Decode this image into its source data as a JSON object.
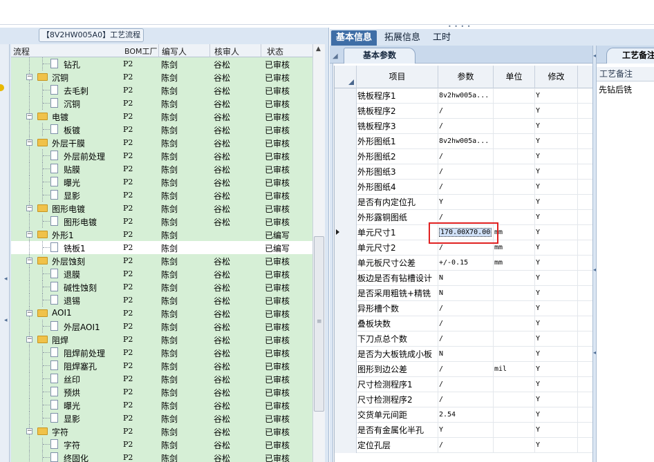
{
  "left": {
    "title": "【8V2HW005A0】工艺流程",
    "headers": {
      "flow": "流程",
      "bom": "BOM工厂",
      "author": "编写人",
      "reviewer": "核审人",
      "status": "状态"
    },
    "rows": [
      {
        "level": 2,
        "type": "doc",
        "name": "钻孔",
        "bom": "P2",
        "author": "陈剑",
        "reviewer": "谷松",
        "status": "已审核"
      },
      {
        "level": 1,
        "type": "folder",
        "name": "沉铜",
        "bom": "P2",
        "author": "陈剑",
        "reviewer": "谷松",
        "status": "已审核"
      },
      {
        "level": 2,
        "type": "doc",
        "name": "去毛刺",
        "bom": "P2",
        "author": "陈剑",
        "reviewer": "谷松",
        "status": "已审核"
      },
      {
        "level": 2,
        "type": "doc",
        "name": "沉铜",
        "bom": "P2",
        "author": "陈剑",
        "reviewer": "谷松",
        "status": "已审核"
      },
      {
        "level": 1,
        "type": "folder",
        "name": "电镀",
        "bom": "P2",
        "author": "陈剑",
        "reviewer": "谷松",
        "status": "已审核"
      },
      {
        "level": 2,
        "type": "doc",
        "name": "板镀",
        "bom": "P2",
        "author": "陈剑",
        "reviewer": "谷松",
        "status": "已审核"
      },
      {
        "level": 1,
        "type": "folder",
        "name": "外层干膜",
        "bom": "P2",
        "author": "陈剑",
        "reviewer": "谷松",
        "status": "已审核"
      },
      {
        "level": 2,
        "type": "doc",
        "name": "外层前处理",
        "bom": "P2",
        "author": "陈剑",
        "reviewer": "谷松",
        "status": "已审核"
      },
      {
        "level": 2,
        "type": "doc",
        "name": "贴膜",
        "bom": "P2",
        "author": "陈剑",
        "reviewer": "谷松",
        "status": "已审核"
      },
      {
        "level": 2,
        "type": "doc",
        "name": "曝光",
        "bom": "P2",
        "author": "陈剑",
        "reviewer": "谷松",
        "status": "已审核"
      },
      {
        "level": 2,
        "type": "doc",
        "name": "显影",
        "bom": "P2",
        "author": "陈剑",
        "reviewer": "谷松",
        "status": "已审核"
      },
      {
        "level": 1,
        "type": "folder",
        "name": "图形电镀",
        "bom": "P2",
        "author": "陈剑",
        "reviewer": "谷松",
        "status": "已审核"
      },
      {
        "level": 2,
        "type": "doc",
        "name": "图形电镀",
        "bom": "P2",
        "author": "陈剑",
        "reviewer": "谷松",
        "status": "已审核"
      },
      {
        "level": 1,
        "type": "folder",
        "name": "外形1",
        "bom": "P2",
        "author": "陈剑",
        "reviewer": "",
        "status": "已编写"
      },
      {
        "level": 2,
        "type": "doc",
        "name": "铣板1",
        "bom": "P2",
        "author": "陈剑",
        "reviewer": "",
        "status": "已编写",
        "selected": true
      },
      {
        "level": 1,
        "type": "folder",
        "name": "外层蚀刻",
        "bom": "P2",
        "author": "陈剑",
        "reviewer": "谷松",
        "status": "已审核"
      },
      {
        "level": 2,
        "type": "doc",
        "name": "退膜",
        "bom": "P2",
        "author": "陈剑",
        "reviewer": "谷松",
        "status": "已审核"
      },
      {
        "level": 2,
        "type": "doc",
        "name": "碱性蚀刻",
        "bom": "P2",
        "author": "陈剑",
        "reviewer": "谷松",
        "status": "已审核"
      },
      {
        "level": 2,
        "type": "doc",
        "name": "退锡",
        "bom": "P2",
        "author": "陈剑",
        "reviewer": "谷松",
        "status": "已审核"
      },
      {
        "level": 1,
        "type": "folder",
        "name": "AOI1",
        "bom": "P2",
        "author": "陈剑",
        "reviewer": "谷松",
        "status": "已审核"
      },
      {
        "level": 2,
        "type": "doc",
        "name": "外层AOI1",
        "bom": "P2",
        "author": "陈剑",
        "reviewer": "谷松",
        "status": "已审核"
      },
      {
        "level": 1,
        "type": "folder",
        "name": "阻焊",
        "bom": "P2",
        "author": "陈剑",
        "reviewer": "谷松",
        "status": "已审核"
      },
      {
        "level": 2,
        "type": "doc",
        "name": "阻焊前处理",
        "bom": "P2",
        "author": "陈剑",
        "reviewer": "谷松",
        "status": "已审核"
      },
      {
        "level": 2,
        "type": "doc",
        "name": "阻焊塞孔",
        "bom": "P2",
        "author": "陈剑",
        "reviewer": "谷松",
        "status": "已审核"
      },
      {
        "level": 2,
        "type": "doc",
        "name": "丝印",
        "bom": "P2",
        "author": "陈剑",
        "reviewer": "谷松",
        "status": "已审核"
      },
      {
        "level": 2,
        "type": "doc",
        "name": "预烘",
        "bom": "P2",
        "author": "陈剑",
        "reviewer": "谷松",
        "status": "已审核"
      },
      {
        "level": 2,
        "type": "doc",
        "name": "曝光",
        "bom": "P2",
        "author": "陈剑",
        "reviewer": "谷松",
        "status": "已审核"
      },
      {
        "level": 2,
        "type": "doc",
        "name": "显影",
        "bom": "P2",
        "author": "陈剑",
        "reviewer": "谷松",
        "status": "已审核"
      },
      {
        "level": 1,
        "type": "folder",
        "name": "字符",
        "bom": "P2",
        "author": "陈剑",
        "reviewer": "谷松",
        "status": "已审核"
      },
      {
        "level": 2,
        "type": "doc",
        "name": "字符",
        "bom": "P2",
        "author": "陈剑",
        "reviewer": "谷松",
        "status": "已审核"
      },
      {
        "level": 2,
        "type": "doc",
        "name": "终固化",
        "bom": "P2",
        "author": "陈剑",
        "reviewer": "谷松",
        "status": "已审核"
      }
    ]
  },
  "tabs": [
    "基本信息",
    "拓展信息",
    "工时"
  ],
  "params": {
    "subtab": "基本参数",
    "headers": {
      "item": "项目",
      "param": "参数",
      "unit": "单位",
      "modify": "修改"
    },
    "rows": [
      {
        "item": "铣板程序1",
        "param": "8v2hw005a...",
        "unit": "",
        "modify": "Y"
      },
      {
        "item": "铣板程序2",
        "param": "/",
        "unit": "",
        "modify": "Y"
      },
      {
        "item": "铣板程序3",
        "param": "/",
        "unit": "",
        "modify": "Y"
      },
      {
        "item": "外形图纸1",
        "param": "8v2hw005a...",
        "unit": "",
        "modify": "Y"
      },
      {
        "item": "外形图纸2",
        "param": "/",
        "unit": "",
        "modify": "Y"
      },
      {
        "item": "外形图纸3",
        "param": "/",
        "unit": "",
        "modify": "Y"
      },
      {
        "item": "外形图纸4",
        "param": "/",
        "unit": "",
        "modify": "Y"
      },
      {
        "item": "是否有内定位孔",
        "param": "Y",
        "unit": "",
        "modify": "Y"
      },
      {
        "item": "外形露铜图纸",
        "param": "/",
        "unit": "",
        "modify": "Y"
      },
      {
        "item": "单元尺寸1",
        "param": "170.00X70.00",
        "unit": "mm",
        "modify": "Y",
        "current": true
      },
      {
        "item": "单元尺寸2",
        "param": "/",
        "unit": "mm",
        "modify": "Y"
      },
      {
        "item": "单元板尺寸公差",
        "param": "+/-0.15",
        "unit": "mm",
        "modify": "Y"
      },
      {
        "item": "板边是否有钻槽设计",
        "param": "N",
        "unit": "",
        "modify": "Y"
      },
      {
        "item": "是否采用粗铣+精铣",
        "param": "N",
        "unit": "",
        "modify": "Y"
      },
      {
        "item": "异形槽个数",
        "param": "/",
        "unit": "",
        "modify": "Y"
      },
      {
        "item": "叠板块数",
        "param": "/",
        "unit": "",
        "modify": "Y"
      },
      {
        "item": "下刀点总个数",
        "param": "/",
        "unit": "",
        "modify": "Y"
      },
      {
        "item": "是否为大板铣成小板",
        "param": "N",
        "unit": "",
        "modify": "Y"
      },
      {
        "item": "图形到边公差",
        "param": "/",
        "unit": "mil",
        "modify": "Y"
      },
      {
        "item": "尺寸检测程序1",
        "param": "/",
        "unit": "",
        "modify": "Y"
      },
      {
        "item": "尺寸检测程序2",
        "param": "/",
        "unit": "",
        "modify": "Y"
      },
      {
        "item": "交货单元间距",
        "param": "2.54",
        "unit": "",
        "modify": "Y"
      },
      {
        "item": "是否有金属化半孔",
        "param": "Y",
        "unit": "",
        "modify": "Y"
      },
      {
        "item": "定位孔层",
        "param": "/",
        "unit": "",
        "modify": "Y"
      }
    ]
  },
  "notes": {
    "tab": "工艺备注",
    "header": "工艺备注",
    "value": "先钻后铣"
  },
  "colors": {
    "tree_bg": "#d6efd6",
    "active_tab": "#3f6ea6",
    "highlight_box": "#e02020",
    "panel_bg": "#dbe6f3"
  }
}
